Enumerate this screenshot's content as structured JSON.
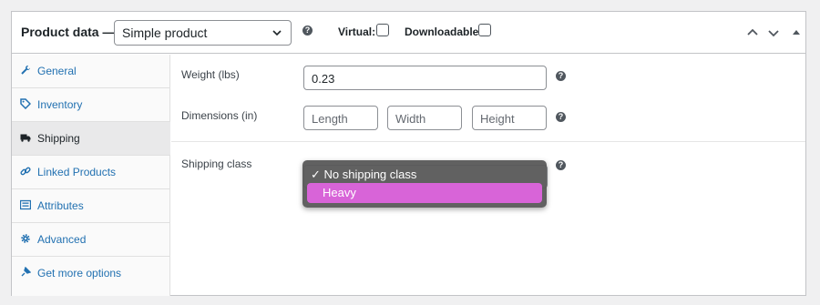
{
  "header": {
    "title": "Product data —",
    "product_type": "Simple product",
    "virtual_label": "Virtual:",
    "virtual_checked": false,
    "downloadable_label": "Downloadable:",
    "downloadable_checked": false,
    "help_glyph": "?"
  },
  "tabs": [
    {
      "label": "General",
      "icon": "wrench-icon",
      "active": false
    },
    {
      "label": "Inventory",
      "icon": "tag-icon",
      "active": false
    },
    {
      "label": "Shipping",
      "icon": "truck-icon",
      "active": true
    },
    {
      "label": "Linked Products",
      "icon": "link-icon",
      "active": false
    },
    {
      "label": "Attributes",
      "icon": "list-icon",
      "active": false
    },
    {
      "label": "Advanced",
      "icon": "gear-icon",
      "active": false
    },
    {
      "label": "Get more options",
      "icon": "plugin-icon",
      "active": false
    }
  ],
  "shipping": {
    "weight_label": "Weight (lbs)",
    "weight_value": "0.23",
    "dimensions_label": "Dimensions (in)",
    "length_placeholder": "Length",
    "width_placeholder": "Width",
    "height_placeholder": "Height",
    "class_label": "Shipping class",
    "class_options": [
      {
        "label": "✓ No shipping class",
        "selected": true
      },
      {
        "label": "Heavy",
        "highlighted": true
      }
    ]
  },
  "colors": {
    "link": "#2271b1",
    "highlight": "#d864d8",
    "dropdown_bg": "#585858"
  }
}
